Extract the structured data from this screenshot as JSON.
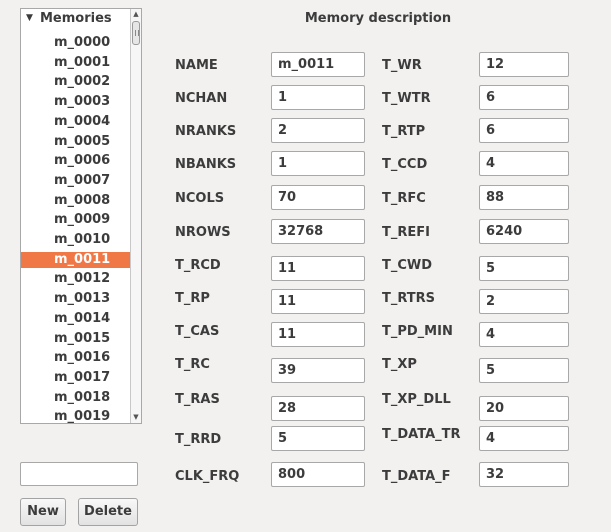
{
  "tree": {
    "root_label": "Memories",
    "items": [
      "m_0000",
      "m_0001",
      "m_0002",
      "m_0003",
      "m_0004",
      "m_0005",
      "m_0006",
      "m_0007",
      "m_0008",
      "m_0009",
      "m_0010",
      "m_0011",
      "m_0012",
      "m_0013",
      "m_0014",
      "m_0015",
      "m_0016",
      "m_0017",
      "m_0018",
      "m_0019"
    ],
    "selected": "m_0011"
  },
  "new_memory_name": "",
  "buttons": {
    "new": "New",
    "delete": "Delete"
  },
  "form": {
    "title": "Memory description",
    "left": [
      {
        "label": "NAME",
        "value": "m_0011"
      },
      {
        "label": "NCHAN",
        "value": "1"
      },
      {
        "label": "NRANKS",
        "value": "2"
      },
      {
        "label": "NBANKS",
        "value": "1"
      },
      {
        "label": "NCOLS",
        "value": "70"
      },
      {
        "label": "NROWS",
        "value": "32768"
      },
      {
        "label": "T_RCD",
        "value": "11"
      },
      {
        "label": "T_RP",
        "value": "11"
      },
      {
        "label": "T_CAS",
        "value": "11"
      },
      {
        "label": "T_RC",
        "value": "39"
      },
      {
        "label": "T_RAS",
        "value": "28"
      },
      {
        "label": "T_RRD",
        "value": "5"
      },
      {
        "label": "CLK_FRQ",
        "value": "800"
      }
    ],
    "right": [
      {
        "label": "T_WR",
        "value": "12"
      },
      {
        "label": "T_WTR",
        "value": "6"
      },
      {
        "label": "T_RTP",
        "value": "6"
      },
      {
        "label": "T_CCD",
        "value": "4"
      },
      {
        "label": "T_RFC",
        "value": "88"
      },
      {
        "label": "T_REFI",
        "value": "6240"
      },
      {
        "label": "T_CWD",
        "value": "5"
      },
      {
        "label": "T_RTRS",
        "value": "2"
      },
      {
        "label": "T_PD_MIN",
        "value": "4"
      },
      {
        "label": "T_XP",
        "value": "5"
      },
      {
        "label": "T_XP_DLL",
        "value": "20"
      },
      {
        "label": "T_DATA_TR",
        "value": "4"
      },
      {
        "label": "T_DATA_F",
        "value": "32"
      }
    ]
  },
  "colors": {
    "selection": "#f07746",
    "window_bg": "#f2f1f0"
  }
}
